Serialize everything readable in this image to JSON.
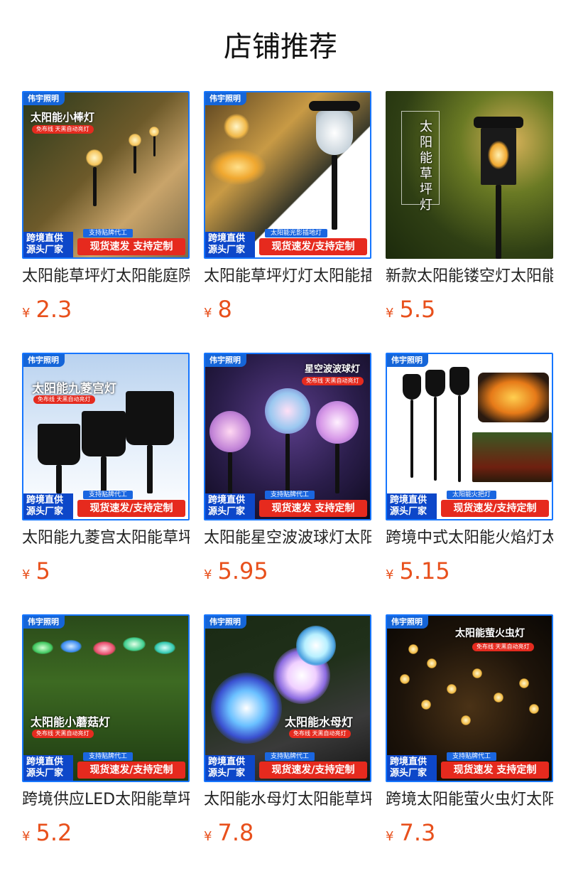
{
  "page": {
    "title": "店铺推荐"
  },
  "products": [
    {
      "name": "太阳能草坪灯太阳能庭院灯",
      "currency": "¥",
      "price": "2.3",
      "thumb": {
        "brand": "伟宇照明",
        "heading": "太阳能小棒灯",
        "pill": "免布线 天黑自动亮灯",
        "tag": "支持贴牌代工",
        "left": "跨境直供\n源头厂家",
        "right": "现货速发 支持定制"
      }
    },
    {
      "name": "太阳能草坪灯灯太阳能插地灯",
      "currency": "¥",
      "price": "8",
      "thumb": {
        "brand": "伟宇照明",
        "heading": "",
        "pill": "",
        "tag": "太阳能光影插地灯",
        "left": "跨境直供\n源头厂家",
        "right": "现货速发/支持定制"
      }
    },
    {
      "name": "新款太阳能镂空灯太阳能草坪灯",
      "currency": "¥",
      "price": "5.5",
      "thumb": {
        "brand": "",
        "heading": "太阳能草坪灯",
        "pill": "",
        "tag": "",
        "left": "",
        "right": ""
      }
    },
    {
      "name": "太阳能九菱宫太阳能草坪灯",
      "currency": "¥",
      "price": "5",
      "thumb": {
        "brand": "伟宇照明",
        "heading": "太阳能九菱宫灯",
        "pill": "免布线 天黑自动亮灯",
        "tag": "支持贴牌代工",
        "left": "跨境直供\n源头厂家",
        "right": "现货速发/支持定制"
      }
    },
    {
      "name": "太阳能星空波波球灯太阳能",
      "currency": "¥",
      "price": "5.95",
      "thumb": {
        "brand": "伟宇照明",
        "heading": "星空波波球灯",
        "pill": "免布线 天黑自动亮灯",
        "tag": "支持贴牌代工",
        "left": "跨境直供\n源头厂家",
        "right": "现货速发 支持定制"
      }
    },
    {
      "name": "跨境中式太阳能火焰灯太阳能",
      "currency": "¥",
      "price": "5.15",
      "thumb": {
        "brand": "伟宇照明",
        "heading": "",
        "pill": "",
        "tag": "太阳能火把灯",
        "left": "跨境直供\n源头厂家",
        "right": "现货速发/支持定制"
      }
    },
    {
      "name": "跨境供应LED太阳能草坪灯",
      "currency": "¥",
      "price": "5.2",
      "thumb": {
        "brand": "伟宇照明",
        "heading": "太阳能小蘑菇灯",
        "pill": "免布线 天黑自动亮灯",
        "tag": "支持贴牌代工",
        "left": "跨境直供\n源头厂家",
        "right": "现货速发/支持定制"
      }
    },
    {
      "name": "太阳能水母灯太阳能草坪灯",
      "currency": "¥",
      "price": "7.8",
      "thumb": {
        "brand": "伟宇照明",
        "heading": "太阳能水母灯",
        "pill": "免布线 天黑自动亮灯",
        "tag": "支持贴牌代工",
        "left": "跨境直供\n源头厂家",
        "right": "现货速发/支持定制"
      }
    },
    {
      "name": "跨境太阳能萤火虫灯太阳能",
      "currency": "¥",
      "price": "7.3",
      "thumb": {
        "brand": "伟宇照明",
        "heading": "太阳能萤火虫灯",
        "pill": "免布线 天黑自动亮灯",
        "tag": "支持贴牌代工",
        "left": "跨境直供\n源头厂家",
        "right": "现货速发 支持定制"
      }
    }
  ]
}
